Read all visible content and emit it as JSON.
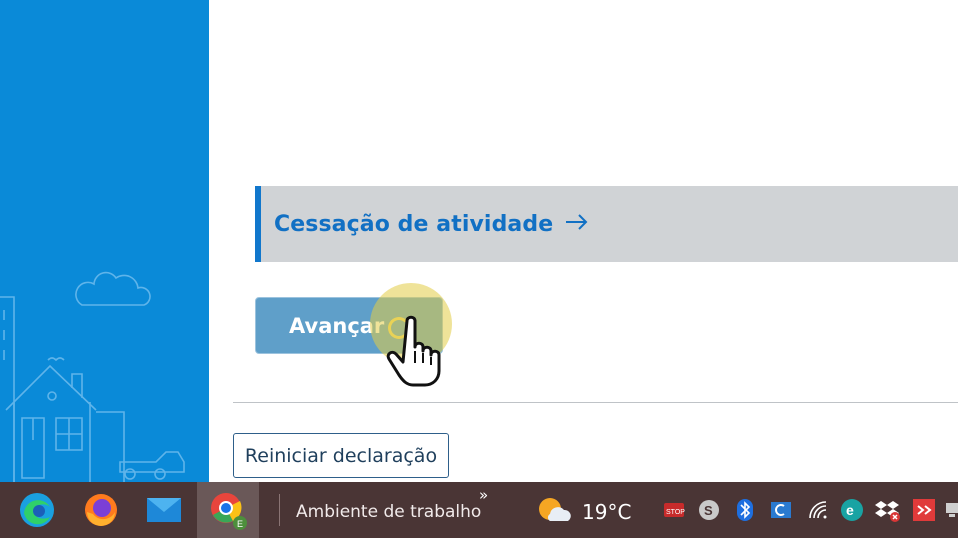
{
  "main": {
    "activity_link": "Cessação de atividade",
    "advance_button": "Avançar",
    "restart_button": "Reiniciar declaração"
  },
  "taskbar": {
    "workspace_label": "Ambiente de trabalho",
    "overflow_glyph": "»",
    "temperature": "19°C",
    "pinned_apps": [
      "edge-icon",
      "firefox-icon",
      "mail-icon",
      "chrome-icon"
    ],
    "tray_icons": [
      "stop-icon",
      "skype-icon",
      "bluetooth-icon",
      "app-icon",
      "wifi-icon",
      "eset-icon",
      "dropbox-icon",
      "anydesk-icon",
      "network-icon"
    ]
  },
  "colors": {
    "sidebar_bg": "#0a8ad8",
    "card_bg": "#d0d3d6",
    "accent": "#1170c4",
    "button_bg": "#5f9fc9",
    "taskbar_bg": "#4a3535"
  }
}
